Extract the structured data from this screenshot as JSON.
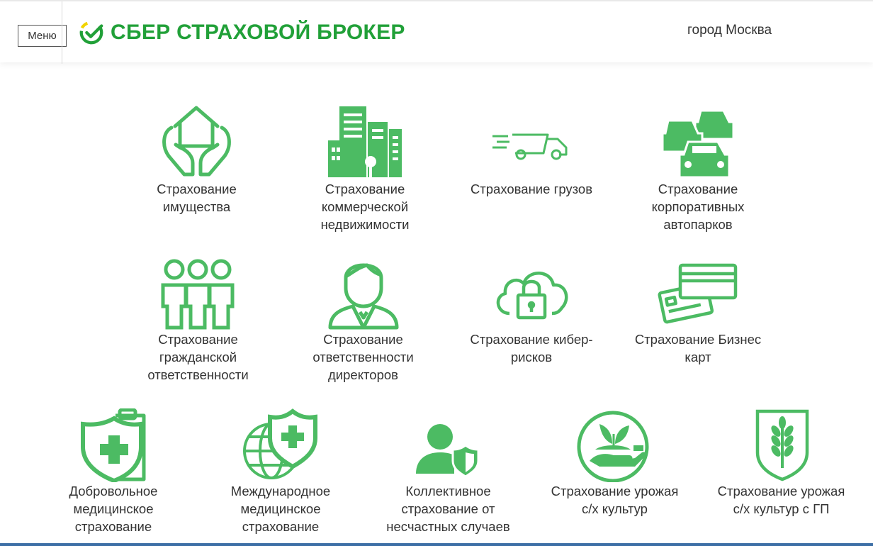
{
  "header": {
    "menu_label": "Меню",
    "logo_text": "СБЕР СТРАХОВОЙ БРОКЕР",
    "city": "город Москва"
  },
  "colors": {
    "brand_green": "#21a038",
    "icon_green": "#4cbb63"
  },
  "tiles": [
    {
      "label": "Страхование\nимущества",
      "icon": "house-hands-icon"
    },
    {
      "label": "Страхование\nкоммерческой\nнедвижимости",
      "icon": "office-buildings-icon"
    },
    {
      "label": "Страхование грузов",
      "icon": "delivery-truck-icon"
    },
    {
      "label": "Страхование\nкорпоративных\nавтопарков",
      "icon": "car-fleet-icon"
    },
    {
      "label": "Страхование\nгражданской\nответственности",
      "icon": "people-group-icon"
    },
    {
      "label": "Страхование\nответственности\nдиректоров",
      "icon": "director-icon"
    },
    {
      "label": "Страхование кибер-\nрисков",
      "icon": "cloud-lock-icon"
    },
    {
      "label": "Страхование Бизнес\nкарт",
      "icon": "credit-cards-icon"
    },
    {
      "label": "Добровольное\nмедицинское\nстрахование",
      "icon": "medical-shield-clipboard-icon"
    },
    {
      "label": "Международное\nмедицинское\nстрахование",
      "icon": "globe-medical-shield-icon"
    },
    {
      "label": "Коллективное\nстрахование от\nнесчастных случаев",
      "icon": "person-shield-icon"
    },
    {
      "label": "Страхование урожая\nс/х культур",
      "icon": "hand-sprout-icon"
    },
    {
      "label": "Страхование урожая\nс/х культур с ГП",
      "icon": "wheat-emblem-icon"
    }
  ]
}
